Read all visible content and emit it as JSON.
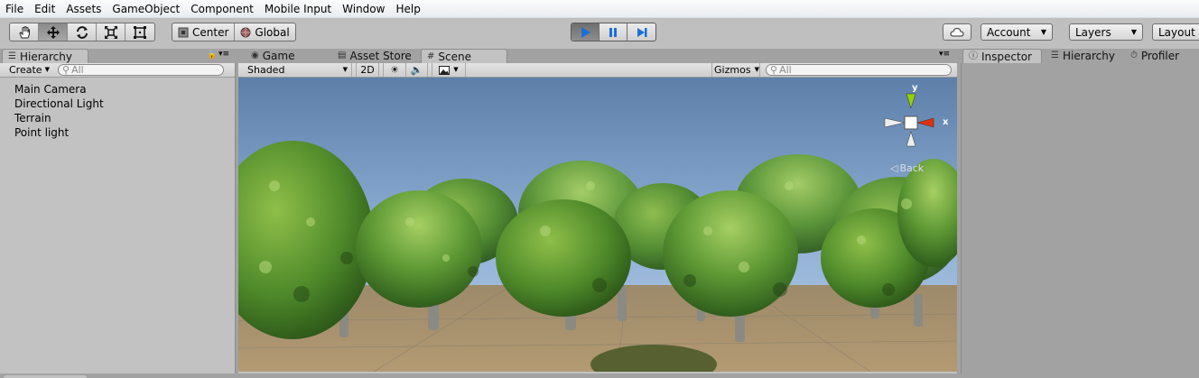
{
  "menu": [
    "File",
    "Edit",
    "Assets",
    "GameObject",
    "Component",
    "Mobile Input",
    "Window",
    "Help"
  ],
  "toolbar": {
    "tools": [
      {
        "name": "hand-tool",
        "icon": "hand-icon",
        "active": false
      },
      {
        "name": "move-tool",
        "icon": "move-icon",
        "active": true
      },
      {
        "name": "rotate-tool",
        "icon": "rotate-icon",
        "active": false
      },
      {
        "name": "scale-tool",
        "icon": "scale-icon",
        "active": false
      },
      {
        "name": "rect-tool",
        "icon": "rect-icon",
        "active": false
      }
    ],
    "pivot_label": "Center",
    "rotation_label": "Global",
    "play_active": true,
    "account_label": "Account",
    "layers_label": "Layers",
    "layout_label": "Layout"
  },
  "hierarchy": {
    "tab_label": "Hierarchy",
    "create_label": "Create",
    "search_placeholder": "All",
    "items": [
      "Main Camera",
      "Directional Light",
      "Terrain",
      "Point light"
    ]
  },
  "center_tabs": {
    "game": "Game",
    "asset_store": "Asset Store",
    "scene": "Scene"
  },
  "scene": {
    "shading_mode": "Shaded",
    "mode_2d": "2D",
    "gizmos_label": "Gizmos",
    "search_placeholder": "All",
    "gizmo_y": "y",
    "gizmo_x": "x",
    "view_label": "Back"
  },
  "right_tabs": {
    "inspector": "Inspector",
    "hierarchy": "Hierarchy",
    "profiler": "Profiler"
  },
  "colors": {
    "play_blue": "#1a6fd8",
    "gizmo_y": "#8fd400",
    "gizmo_x": "#e03010"
  }
}
